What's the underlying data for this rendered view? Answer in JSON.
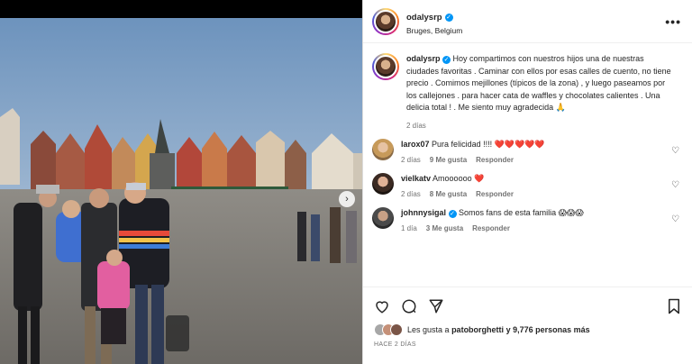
{
  "post": {
    "username": "odalysrp",
    "location": "Bruges, Belgium",
    "caption_user": "odalysrp",
    "caption": "Hoy compartimos con nuestros hijos una de nuestras ciudades favoritas . Caminar con ellos por esas calles de cuento, no tiene precio . Comimos mejillones (típicos de la zona) , y luego paseamos por los callejones . para hacer cata de waffles y chocolates calientes . Una delicia total ! . Me siento muy agradecida 🙏",
    "caption_time": "2 días",
    "more_icon": "•••"
  },
  "comments": [
    {
      "user": "larox07",
      "text": "Pura felicidad !!!! ❤️❤️❤️❤️❤️",
      "time": "2 días",
      "likes": "9 Me gusta",
      "reply": "Responder"
    },
    {
      "user": "vielkatv",
      "text": "Amoooooo ❤️",
      "time": "2 días",
      "likes": "8 Me gusta",
      "reply": "Responder"
    },
    {
      "user": "johnnysigal",
      "text": "Somos fans de esta familia 😱😱😱",
      "time": "1 día",
      "likes": "3 Me gusta",
      "reply": "Responder"
    }
  ],
  "likes": {
    "prefix": "Les gusta a",
    "user": "patoborghetti",
    "suffix": "y 9,776 personas más"
  },
  "date": "HACE 2 DÍAS",
  "icons": [
    "heart-icon",
    "comment-icon",
    "share-icon",
    "bookmark-icon",
    "chevron-right-icon"
  ],
  "colors": {
    "verified": "#0095f6",
    "secondary_text": "#737373"
  }
}
